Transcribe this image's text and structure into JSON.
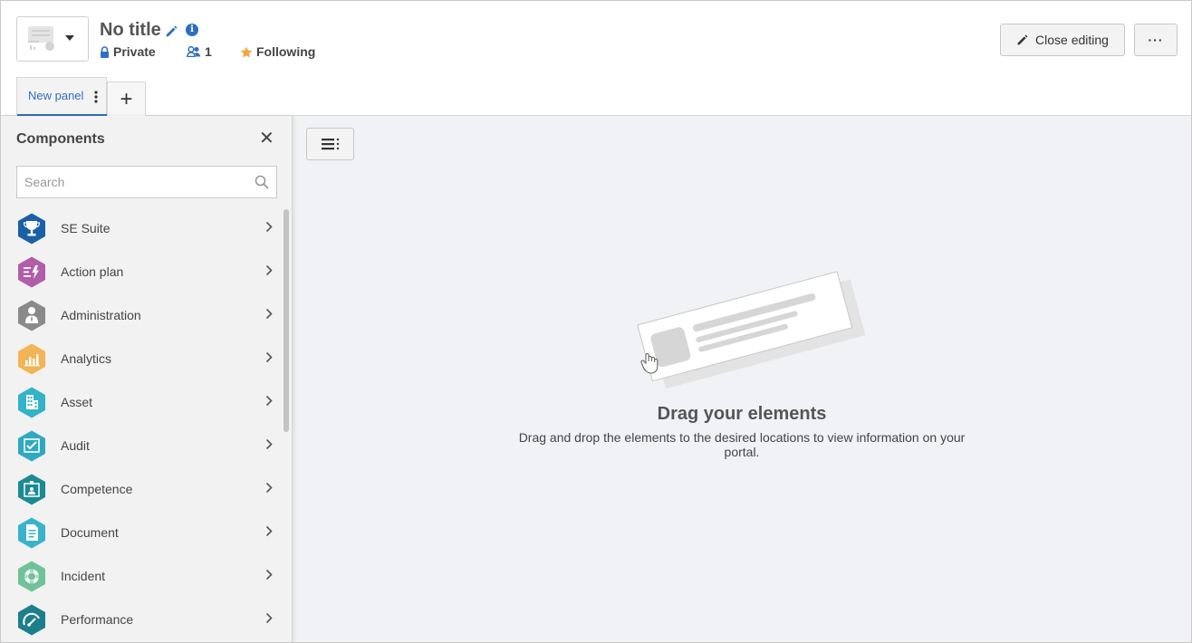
{
  "header": {
    "title": "No title",
    "privacy": "Private",
    "members_count": "1",
    "following": "Following",
    "close_editing": "Close editing",
    "more": "···"
  },
  "tabs": [
    {
      "label": "New panel",
      "active": true
    }
  ],
  "add_tab": "+",
  "sidebar": {
    "title": "Components",
    "close": "✕",
    "search_placeholder": "Search",
    "items": [
      {
        "label": "SE Suite",
        "icon": "trophy-icon",
        "color": "#1b5fa7"
      },
      {
        "label": "Action plan",
        "icon": "action-plan-icon",
        "color": "#b05ea7"
      },
      {
        "label": "Administration",
        "icon": "admin-user-icon",
        "color": "#8a8a8a"
      },
      {
        "label": "Analytics",
        "icon": "bar-chart-icon",
        "color": "#f3b457"
      },
      {
        "label": "Asset",
        "icon": "building-icon",
        "color": "#33b3c9"
      },
      {
        "label": "Audit",
        "icon": "audit-icon",
        "color": "#2fa9c0"
      },
      {
        "label": "Competence",
        "icon": "competence-icon",
        "color": "#1c8a94"
      },
      {
        "label": "Document",
        "icon": "document-icon",
        "color": "#3ab3cc"
      },
      {
        "label": "Incident",
        "icon": "lifebuoy-icon",
        "color": "#6fc29a"
      },
      {
        "label": "Performance",
        "icon": "gauge-icon",
        "color": "#1c7f8c"
      }
    ]
  },
  "empty_state": {
    "title": "Drag your elements",
    "text": "Drag and drop the elements to the desired locations to view information on your portal."
  }
}
